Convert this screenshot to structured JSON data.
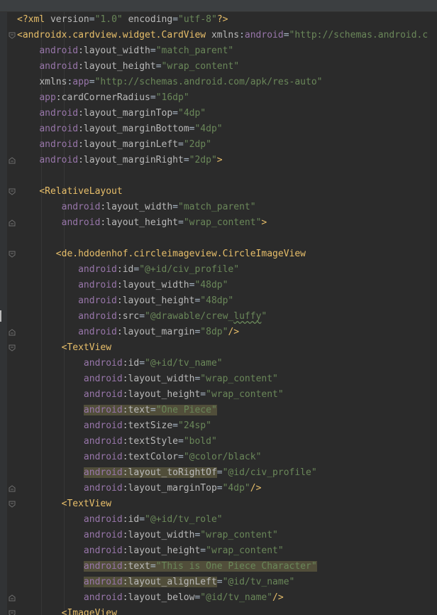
{
  "editor": {
    "language": "xml",
    "lines": [
      {
        "indent": "",
        "parts": [
          {
            "t": "<?xml ",
            "c": "tag"
          },
          {
            "t": "version",
            "c": "attr"
          },
          {
            "t": "=",
            "c": "eq"
          },
          {
            "t": "\"1.0\"",
            "c": "val"
          },
          {
            "t": " ",
            "c": "eq"
          },
          {
            "t": "encoding",
            "c": "attr"
          },
          {
            "t": "=",
            "c": "eq"
          },
          {
            "t": "\"utf-8\"",
            "c": "val"
          },
          {
            "t": "?>",
            "c": "tag"
          }
        ]
      },
      {
        "indent": "",
        "fold": "open",
        "parts": [
          {
            "t": "<androidx.cardview.widget.CardView ",
            "c": "tag"
          },
          {
            "t": "xmlns",
            "c": "attr"
          },
          {
            "t": ":",
            "c": "eq"
          },
          {
            "t": "android",
            "c": "ns"
          },
          {
            "t": "=",
            "c": "eq"
          },
          {
            "t": "\"http://schemas.android.c",
            "c": "val"
          }
        ]
      },
      {
        "indent": "    ",
        "parts": [
          {
            "t": "android",
            "c": "ns"
          },
          {
            "t": ":layout_width",
            "c": "attr"
          },
          {
            "t": "=",
            "c": "eq"
          },
          {
            "t": "\"match_parent\"",
            "c": "val"
          }
        ]
      },
      {
        "indent": "    ",
        "parts": [
          {
            "t": "android",
            "c": "ns"
          },
          {
            "t": ":layout_height",
            "c": "attr"
          },
          {
            "t": "=",
            "c": "eq"
          },
          {
            "t": "\"wrap_content\"",
            "c": "val"
          }
        ]
      },
      {
        "indent": "    ",
        "parts": [
          {
            "t": "xmlns",
            "c": "attr"
          },
          {
            "t": ":",
            "c": "eq"
          },
          {
            "t": "app",
            "c": "ns"
          },
          {
            "t": "=",
            "c": "eq"
          },
          {
            "t": "\"http://schemas.android.com/apk/res-auto\"",
            "c": "val"
          }
        ]
      },
      {
        "indent": "    ",
        "parts": [
          {
            "t": "app",
            "c": "ns"
          },
          {
            "t": ":cardCornerRadius",
            "c": "attr"
          },
          {
            "t": "=",
            "c": "eq"
          },
          {
            "t": "\"16dp\"",
            "c": "val"
          }
        ]
      },
      {
        "indent": "    ",
        "parts": [
          {
            "t": "android",
            "c": "ns"
          },
          {
            "t": ":layout_marginTop",
            "c": "attr"
          },
          {
            "t": "=",
            "c": "eq"
          },
          {
            "t": "\"4dp\"",
            "c": "val"
          }
        ]
      },
      {
        "indent": "    ",
        "parts": [
          {
            "t": "android",
            "c": "ns"
          },
          {
            "t": ":layout_marginBottom",
            "c": "attr"
          },
          {
            "t": "=",
            "c": "eq"
          },
          {
            "t": "\"4dp\"",
            "c": "val"
          }
        ]
      },
      {
        "indent": "    ",
        "parts": [
          {
            "t": "android",
            "c": "ns"
          },
          {
            "t": ":layout_marginLeft",
            "c": "attr"
          },
          {
            "t": "=",
            "c": "eq"
          },
          {
            "t": "\"2dp\"",
            "c": "val"
          }
        ]
      },
      {
        "indent": "    ",
        "fold": "end",
        "parts": [
          {
            "t": "android",
            "c": "ns"
          },
          {
            "t": ":layout_marginRight",
            "c": "attr"
          },
          {
            "t": "=",
            "c": "eq"
          },
          {
            "t": "\"2dp\"",
            "c": "val"
          },
          {
            "t": ">",
            "c": "tag"
          }
        ]
      },
      {
        "indent": "",
        "parts": []
      },
      {
        "indent": "    ",
        "fold": "open",
        "parts": [
          {
            "t": "<RelativeLayout",
            "c": "tag"
          }
        ]
      },
      {
        "indent": "        ",
        "parts": [
          {
            "t": "android",
            "c": "ns"
          },
          {
            "t": ":layout_width",
            "c": "attr"
          },
          {
            "t": "=",
            "c": "eq"
          },
          {
            "t": "\"match_parent\"",
            "c": "val"
          }
        ]
      },
      {
        "indent": "        ",
        "fold": "end",
        "parts": [
          {
            "t": "android",
            "c": "ns"
          },
          {
            "t": ":layout_height",
            "c": "attr"
          },
          {
            "t": "=",
            "c": "eq"
          },
          {
            "t": "\"wrap_content\"",
            "c": "val"
          },
          {
            "t": ">",
            "c": "tag"
          }
        ]
      },
      {
        "indent": "",
        "parts": []
      },
      {
        "indent": "       ",
        "fold": "open",
        "parts": [
          {
            "t": "<de.hdodenhof.circleimageview.CircleImageView",
            "c": "tag"
          }
        ]
      },
      {
        "indent": "           ",
        "parts": [
          {
            "t": "android",
            "c": "ns"
          },
          {
            "t": ":id",
            "c": "attr"
          },
          {
            "t": "=",
            "c": "eq"
          },
          {
            "t": "\"@+id/civ_profile\"",
            "c": "val"
          }
        ]
      },
      {
        "indent": "           ",
        "parts": [
          {
            "t": "android",
            "c": "ns"
          },
          {
            "t": ":layout_width",
            "c": "attr"
          },
          {
            "t": "=",
            "c": "eq"
          },
          {
            "t": "\"48dp\"",
            "c": "val"
          }
        ]
      },
      {
        "indent": "           ",
        "parts": [
          {
            "t": "android",
            "c": "ns"
          },
          {
            "t": ":layout_height",
            "c": "attr"
          },
          {
            "t": "=",
            "c": "eq"
          },
          {
            "t": "\"48dp\"",
            "c": "val"
          }
        ]
      },
      {
        "indent": "           ",
        "parts": [
          {
            "t": "android",
            "c": "ns"
          },
          {
            "t": ":src",
            "c": "attr"
          },
          {
            "t": "=",
            "c": "eq"
          },
          {
            "t": "\"@drawable/crew_",
            "c": "val"
          },
          {
            "t": "luffy",
            "c": "val warn"
          },
          {
            "t": "\"",
            "c": "val"
          }
        ]
      },
      {
        "indent": "           ",
        "fold": "end",
        "parts": [
          {
            "t": "android",
            "c": "ns"
          },
          {
            "t": ":layout_margin",
            "c": "attr"
          },
          {
            "t": "=",
            "c": "eq"
          },
          {
            "t": "\"8dp\"",
            "c": "val"
          },
          {
            "t": "/>",
            "c": "tag"
          }
        ]
      },
      {
        "indent": "        ",
        "fold": "open",
        "parts": [
          {
            "t": "<TextView",
            "c": "tag"
          }
        ]
      },
      {
        "indent": "            ",
        "parts": [
          {
            "t": "android",
            "c": "ns"
          },
          {
            "t": ":id",
            "c": "attr"
          },
          {
            "t": "=",
            "c": "eq"
          },
          {
            "t": "\"@+id/tv_name\"",
            "c": "val"
          }
        ]
      },
      {
        "indent": "            ",
        "parts": [
          {
            "t": "android",
            "c": "ns"
          },
          {
            "t": ":layout_width",
            "c": "attr"
          },
          {
            "t": "=",
            "c": "eq"
          },
          {
            "t": "\"wrap_content\"",
            "c": "val"
          }
        ]
      },
      {
        "indent": "            ",
        "parts": [
          {
            "t": "android",
            "c": "ns"
          },
          {
            "t": ":layout_height",
            "c": "attr"
          },
          {
            "t": "=",
            "c": "eq"
          },
          {
            "t": "\"wrap_content\"",
            "c": "val"
          }
        ]
      },
      {
        "indent": "            ",
        "parts": [
          {
            "t": "android",
            "c": "ns hl"
          },
          {
            "t": ":text",
            "c": "attr hl"
          },
          {
            "t": "=",
            "c": "eq hl"
          },
          {
            "t": "\"One Piece\"",
            "c": "val hl"
          }
        ]
      },
      {
        "indent": "            ",
        "parts": [
          {
            "t": "android",
            "c": "ns"
          },
          {
            "t": ":textSize",
            "c": "attr"
          },
          {
            "t": "=",
            "c": "eq"
          },
          {
            "t": "\"24sp\"",
            "c": "val"
          }
        ]
      },
      {
        "indent": "            ",
        "parts": [
          {
            "t": "android",
            "c": "ns"
          },
          {
            "t": ":textStyle",
            "c": "attr"
          },
          {
            "t": "=",
            "c": "eq"
          },
          {
            "t": "\"bold\"",
            "c": "val"
          }
        ]
      },
      {
        "indent": "            ",
        "parts": [
          {
            "t": "android",
            "c": "ns"
          },
          {
            "t": ":textColor",
            "c": "attr"
          },
          {
            "t": "=",
            "c": "eq"
          },
          {
            "t": "\"@color/black\"",
            "c": "val"
          }
        ]
      },
      {
        "indent": "            ",
        "parts": [
          {
            "t": "android",
            "c": "ns hl"
          },
          {
            "t": ":layout_toRightOf",
            "c": "attr hl"
          },
          {
            "t": "=",
            "c": "eq"
          },
          {
            "t": "\"@id/civ_profile\"",
            "c": "val"
          }
        ]
      },
      {
        "indent": "            ",
        "fold": "end",
        "parts": [
          {
            "t": "android",
            "c": "ns"
          },
          {
            "t": ":layout_marginTop",
            "c": "attr"
          },
          {
            "t": "=",
            "c": "eq"
          },
          {
            "t": "\"4dp\"",
            "c": "val"
          },
          {
            "t": "/>",
            "c": "tag"
          }
        ]
      },
      {
        "indent": "        ",
        "fold": "open",
        "parts": [
          {
            "t": "<TextView",
            "c": "tag"
          }
        ]
      },
      {
        "indent": "            ",
        "parts": [
          {
            "t": "android",
            "c": "ns"
          },
          {
            "t": ":id",
            "c": "attr"
          },
          {
            "t": "=",
            "c": "eq"
          },
          {
            "t": "\"@+id/tv_role\"",
            "c": "val"
          }
        ]
      },
      {
        "indent": "            ",
        "parts": [
          {
            "t": "android",
            "c": "ns"
          },
          {
            "t": ":layout_width",
            "c": "attr"
          },
          {
            "t": "=",
            "c": "eq"
          },
          {
            "t": "\"wrap_content\"",
            "c": "val"
          }
        ]
      },
      {
        "indent": "            ",
        "parts": [
          {
            "t": "android",
            "c": "ns"
          },
          {
            "t": ":layout_height",
            "c": "attr"
          },
          {
            "t": "=",
            "c": "eq"
          },
          {
            "t": "\"wrap_content\"",
            "c": "val"
          }
        ]
      },
      {
        "indent": "            ",
        "parts": [
          {
            "t": "android",
            "c": "ns hl"
          },
          {
            "t": ":text",
            "c": "attr hl"
          },
          {
            "t": "=",
            "c": "eq hl"
          },
          {
            "t": "\"This is One Piece Character\"",
            "c": "val hl"
          }
        ]
      },
      {
        "indent": "            ",
        "parts": [
          {
            "t": "android",
            "c": "ns hl"
          },
          {
            "t": ":layout_alignLeft",
            "c": "attr hl"
          },
          {
            "t": "=",
            "c": "eq"
          },
          {
            "t": "\"@id/tv_name\"",
            "c": "val"
          }
        ]
      },
      {
        "indent": "            ",
        "fold": "end",
        "parts": [
          {
            "t": "android",
            "c": "ns"
          },
          {
            "t": ":layout_below",
            "c": "attr"
          },
          {
            "t": "=",
            "c": "eq"
          },
          {
            "t": "\"@id/tv_name\"",
            "c": "val"
          },
          {
            "t": "/>",
            "c": "tag"
          }
        ]
      },
      {
        "indent": "        ",
        "fold": "open",
        "parts": [
          {
            "t": "<ImageView",
            "c": "tag"
          }
        ]
      }
    ]
  }
}
